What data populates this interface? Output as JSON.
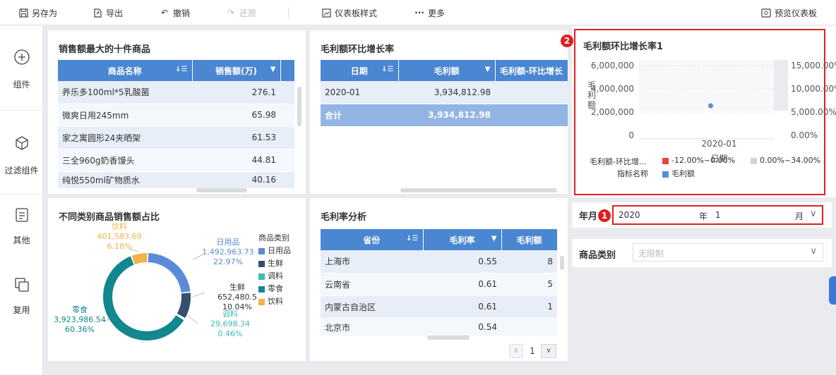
{
  "toolbar": {
    "save_as": "另存为",
    "export": "导出",
    "undo": "撤销",
    "redo": "还原",
    "dashboard_style": "仪表板样式",
    "more": "更多",
    "preview": "预览仪表板"
  },
  "sidebar": {
    "components": "组件",
    "filter_components": "过滤组件",
    "other": "其他",
    "reuse": "复用"
  },
  "top10": {
    "title": "销售额最大的十件商品",
    "headers": [
      "商品名称",
      "销售额(万)"
    ],
    "rows": [
      [
        "养乐多100ml*5乳酸菌",
        "276.1"
      ],
      [
        "微爽日用245mm",
        "65.98"
      ],
      [
        "家之寓圆形24夹晒架",
        "61.53"
      ],
      [
        "三全960g奶香馒头",
        "44.81"
      ],
      [
        "纯悦550ml矿物质水",
        "40.16"
      ]
    ]
  },
  "mom": {
    "title": "毛利额环比增长率",
    "headers": [
      "日期",
      "毛利额",
      "毛利额-环比增长"
    ],
    "rows": [
      [
        "2020-01",
        "3,934,812.98",
        ""
      ]
    ],
    "total": [
      "合计",
      "3,934,812.98",
      ""
    ]
  },
  "mom1": {
    "title": "毛利额环比增长率1",
    "callout": "2",
    "chart_data": {
      "type": "scatter",
      "title": "毛利额环比增长率1",
      "xlabel": "日期",
      "ylabel_left": "毛利额",
      "ylabel_right": "毛利额-环比",
      "x": [
        "2020-01"
      ],
      "series": [
        {
          "name": "毛利额",
          "values": [
            3934812.98
          ]
        }
      ],
      "left_ticks": [
        "6,000,000",
        "4,000,000",
        "2,000,000",
        "0"
      ],
      "right_ticks": [
        "15,000.00%",
        "10,000.00%",
        "5,000.00%",
        "0.00%"
      ],
      "ylim": [
        0,
        6000000
      ]
    },
    "legend_left_label": "毛利额-环比增...",
    "legend_ranges": [
      {
        "label": "-12.00%~0.00%",
        "color": "#e8453c"
      },
      {
        "label": "0.00%~34.00%",
        "color": "#c8d3e6"
      }
    ],
    "indicator_label": "指标名称",
    "indicator_item": {
      "label": "毛利额",
      "color": "#5b8bd6"
    }
  },
  "category_pie": {
    "title": "不同类别商品销售额占比",
    "legend_title": "商品类别",
    "chart_data": {
      "type": "pie",
      "categories": [
        "日用品",
        "生鲜",
        "调料",
        "零食",
        "饮料"
      ],
      "values": [
        1492963.73,
        652480.5,
        29698.34,
        3923986.54,
        401583.69
      ],
      "percents": [
        "22.97%",
        "10.04%",
        "0.46%",
        "60.36%",
        "6.18%"
      ],
      "value_labels": [
        "1,492,963.73",
        "652,480.5",
        "29,698.34",
        "3,923,986.54",
        "401,583.69"
      ],
      "colors": [
        "#5b8bd6",
        "#35506e",
        "#3fbcb0",
        "#12878f",
        "#f2b24a"
      ]
    }
  },
  "margin": {
    "title": "毛利率分析",
    "headers": [
      "省份",
      "毛利率",
      "毛利额"
    ],
    "rows": [
      [
        "上海市",
        "0.55",
        "8"
      ],
      [
        "云南省",
        "0.61",
        "5"
      ],
      [
        "内蒙古自治区",
        "0.61",
        "1"
      ],
      [
        "北京市",
        "0.54",
        ""
      ]
    ],
    "page": "1"
  },
  "filter_month": {
    "label": "年月",
    "callout": "1",
    "year": "2020",
    "year_unit": "年",
    "month": "1",
    "month_unit": "月"
  },
  "filter_category": {
    "label": "商品类别",
    "placeholder": "无限制"
  }
}
